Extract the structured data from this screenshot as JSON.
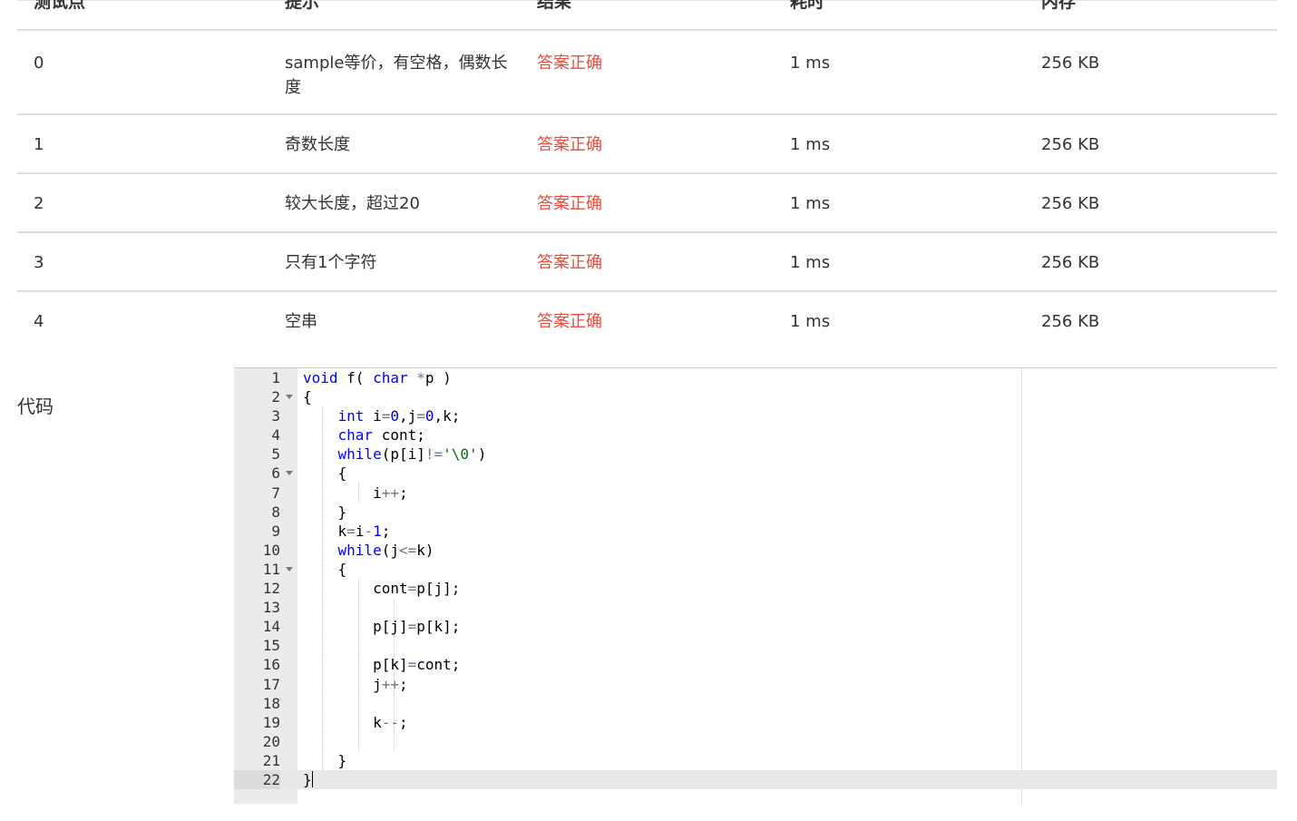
{
  "table": {
    "headers": [
      "测试点",
      "提示",
      "结果",
      "耗时",
      "内存"
    ],
    "rows": [
      {
        "id": "0",
        "hint": "sample等价，有空格，偶数长度",
        "result": "答案正确",
        "time": "1 ms",
        "memory": "256 KB"
      },
      {
        "id": "1",
        "hint": "奇数长度",
        "result": "答案正确",
        "time": "1 ms",
        "memory": "256 KB"
      },
      {
        "id": "2",
        "hint": "较大长度，超过20",
        "result": "答案正确",
        "time": "1 ms",
        "memory": "256 KB"
      },
      {
        "id": "3",
        "hint": "只有1个字符",
        "result": "答案正确",
        "time": "1 ms",
        "memory": "256 KB"
      },
      {
        "id": "4",
        "hint": "空串",
        "result": "答案正确",
        "time": "1 ms",
        "memory": "256 KB"
      }
    ]
  },
  "code_section": {
    "label": "代码",
    "active_line": 22,
    "fold_lines": [
      2,
      6,
      11
    ],
    "lines": [
      "void f( char *p )",
      "{",
      "    int i=0,j=0,k;",
      "    char cont;",
      "    while(p[i]!='\\0')",
      "    {",
      "        i++;",
      "    }",
      "    k=i-1;",
      "    while(j<=k)",
      "    {",
      "        cont=p[j];",
      "",
      "        p[j]=p[k];",
      "",
      "        p[k]=cont;",
      "        j++;",
      "",
      "        k--;",
      "",
      "    }",
      "}"
    ]
  }
}
